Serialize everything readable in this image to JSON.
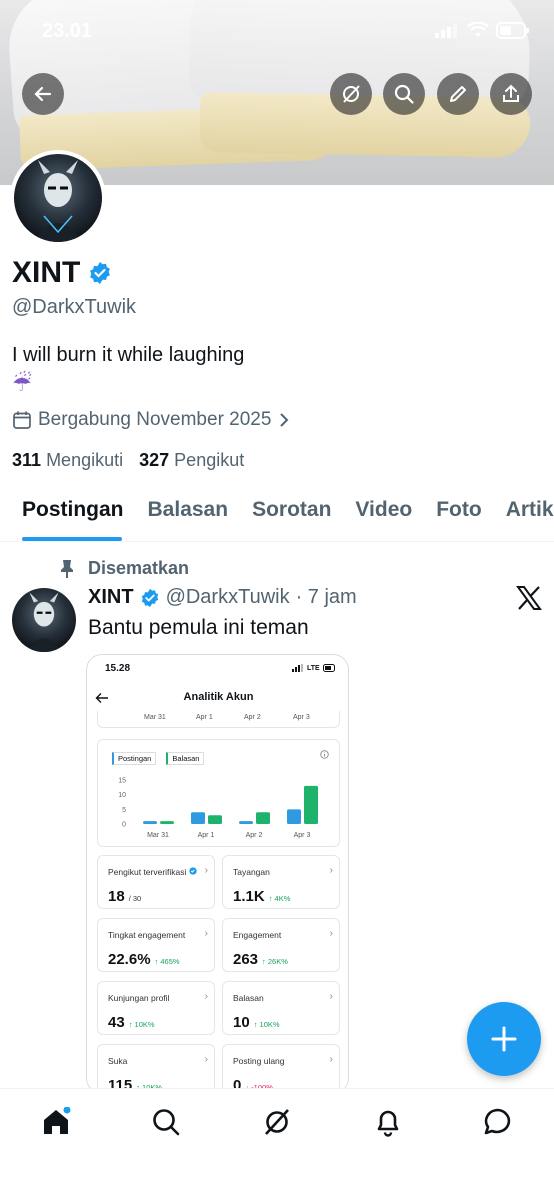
{
  "status_bar": {
    "time": "23.01"
  },
  "profile": {
    "name": "XINT",
    "handle": "@DarkxTuwik",
    "bio": "I will burn it while laughing",
    "bio_emoji": "☔",
    "joined": "Bergabung November 2025",
    "following_count": "311",
    "following_label": "Mengikuti",
    "followers_count": "327",
    "followers_label": "Pengikut"
  },
  "tabs": [
    {
      "label": "Postingan",
      "active": true
    },
    {
      "label": "Balasan"
    },
    {
      "label": "Sorotan"
    },
    {
      "label": "Video"
    },
    {
      "label": "Foto"
    },
    {
      "label": "Artikel"
    }
  ],
  "post": {
    "pinned_label": "Disematkan",
    "author_name": "XINT",
    "author_handle": "@DarkxTuwik",
    "time": "· 7 jam",
    "text": "Bantu pemula ini teman"
  },
  "screenshot": {
    "time": "15.28",
    "network": "LTE",
    "title": "Analitik Akun",
    "top_dates": [
      "Mar 31",
      "Apr 1",
      "Apr 2",
      "Apr 3"
    ],
    "legend": [
      "Postingan",
      "Balasan"
    ],
    "chart_data": {
      "type": "bar",
      "categories": [
        "Mar 31",
        "Apr 1",
        "Apr 2",
        "Apr 3"
      ],
      "series": [
        {
          "name": "Postingan",
          "values": [
            1,
            4,
            1,
            5
          ]
        },
        {
          "name": "Balasan",
          "values": [
            1,
            3,
            4,
            13
          ]
        }
      ],
      "ylim": [
        0,
        15
      ],
      "yticks": [
        "15",
        "10",
        "5",
        "0"
      ]
    },
    "metrics": [
      {
        "label": "Pengikut terverifikasi",
        "value": "18",
        "suffix": "/ 30",
        "change": ""
      },
      {
        "label": "Tayangan",
        "value": "1.1K",
        "suffix": "",
        "change": "↑ 4K%"
      },
      {
        "label": "Tingkat engagement",
        "value": "22.6%",
        "suffix": "",
        "change": "↑ 465%"
      },
      {
        "label": "Engagement",
        "value": "263",
        "suffix": "",
        "change": "↑ 26K%"
      },
      {
        "label": "Kunjungan profil",
        "value": "43",
        "suffix": "",
        "change": "↑ 10K%"
      },
      {
        "label": "Balasan",
        "value": "10",
        "suffix": "",
        "change": "↑ 10K%"
      },
      {
        "label": "Suka",
        "value": "115",
        "suffix": "",
        "change": "↑ 10K%"
      },
      {
        "label": "Posting ulang",
        "value": "0",
        "suffix": "",
        "change": "↓ -100%"
      }
    ]
  },
  "colors": {
    "accent": "#1d9bf0",
    "postingan_bar": "#2f9ae0",
    "balasan_bar": "#1fb26b"
  }
}
